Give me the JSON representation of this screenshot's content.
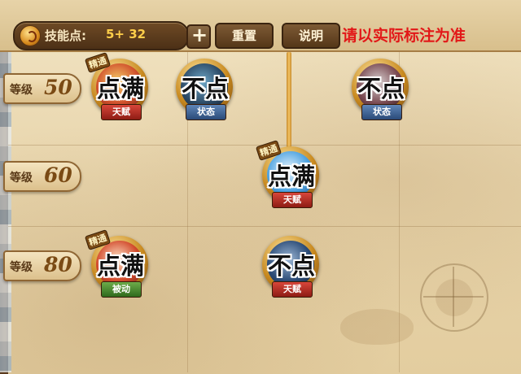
{
  "header": {
    "points_label": "技能点:",
    "points_value": "5+ 32",
    "plus_symbol": "+",
    "reset_label": "重置",
    "help_label": "说明",
    "note": "请以实际标注为准"
  },
  "levels": [
    {
      "label": "等级",
      "value": "50"
    },
    {
      "label": "等级",
      "value": "60"
    },
    {
      "label": "等级",
      "value": "80"
    }
  ],
  "skills": [
    {
      "mastery": "精通",
      "type": "天赋",
      "annotation": "点满"
    },
    {
      "mastery": "",
      "type": "状态",
      "annotation": "不点"
    },
    {
      "mastery": "",
      "type": "状态",
      "annotation": "不点"
    },
    {
      "mastery": "精通",
      "type": "天赋",
      "annotation": "点满"
    },
    {
      "mastery": "精通",
      "type": "被动",
      "annotation": "点满"
    },
    {
      "mastery": "",
      "type": "天赋",
      "annotation": "不点"
    }
  ],
  "colors": {
    "note_red": "#e21818",
    "banner_talent": "#b22a20",
    "banner_status": "#3f649a",
    "banner_passive": "#46862e"
  },
  "icons": {
    "points": "coin-icon",
    "add": "plus-icon"
  }
}
